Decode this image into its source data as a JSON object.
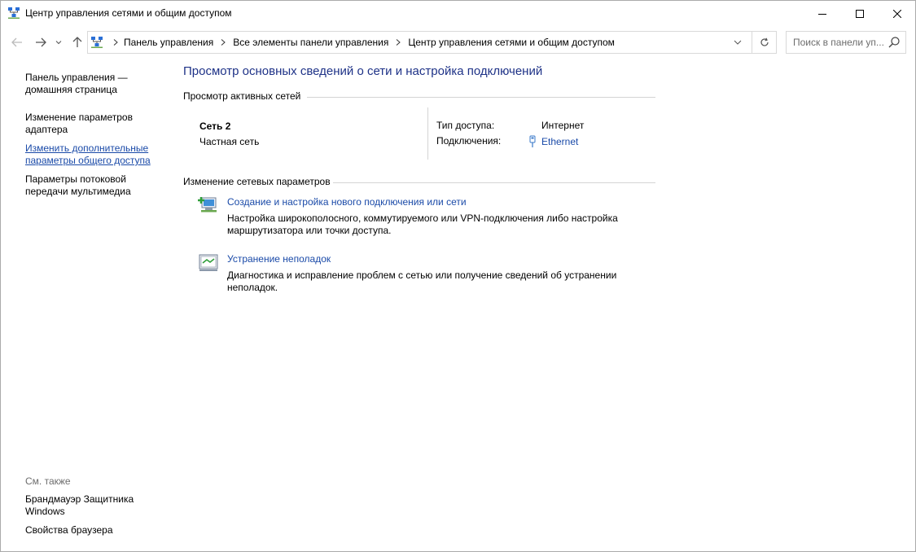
{
  "window": {
    "title": "Центр управления сетями и общим доступом"
  },
  "navbar": {
    "breadcrumbs": [
      "Панель управления",
      "Все элементы панели управления",
      "Центр управления сетями и общим доступом"
    ],
    "search_placeholder": "Поиск в панели уп..."
  },
  "sidebar": {
    "items": [
      {
        "label": "Панель управления — домашняя страница"
      },
      {
        "label": "Изменение параметров адаптера"
      },
      {
        "label": "Изменить дополнительные параметры общего доступа"
      },
      {
        "label": "Параметры потоковой передачи мультимедиа"
      }
    ],
    "see_also_label": "См. также",
    "see_also_items": [
      {
        "label": "Брандмауэр Защитника Windows"
      },
      {
        "label": "Свойства браузера"
      }
    ]
  },
  "main": {
    "title": "Просмотр основных сведений о сети и настройка подключений",
    "active_networks_heading": "Просмотр активных сетей",
    "network": {
      "name": "Сеть 2",
      "type": "Частная сеть",
      "access_type_label": "Тип доступа:",
      "access_type_value": "Интернет",
      "connections_label": "Подключения:",
      "connections_value": "Ethernet"
    },
    "change_settings_heading": "Изменение сетевых параметров",
    "tasks": [
      {
        "link": "Создание и настройка нового подключения или сети",
        "description": "Настройка широкополосного, коммутируемого или VPN-подключения либо настройка маршрутизатора или точки доступа.",
        "icon": "new-connection-icon"
      },
      {
        "link": "Устранение неполадок",
        "description": "Диагностика и исправление проблем с сетью или получение сведений об устранении неполадок.",
        "icon": "troubleshoot-icon"
      }
    ]
  },
  "colors": {
    "link": "#1a4aa8",
    "title": "#1e3287",
    "muted": "#6d6d6d"
  }
}
